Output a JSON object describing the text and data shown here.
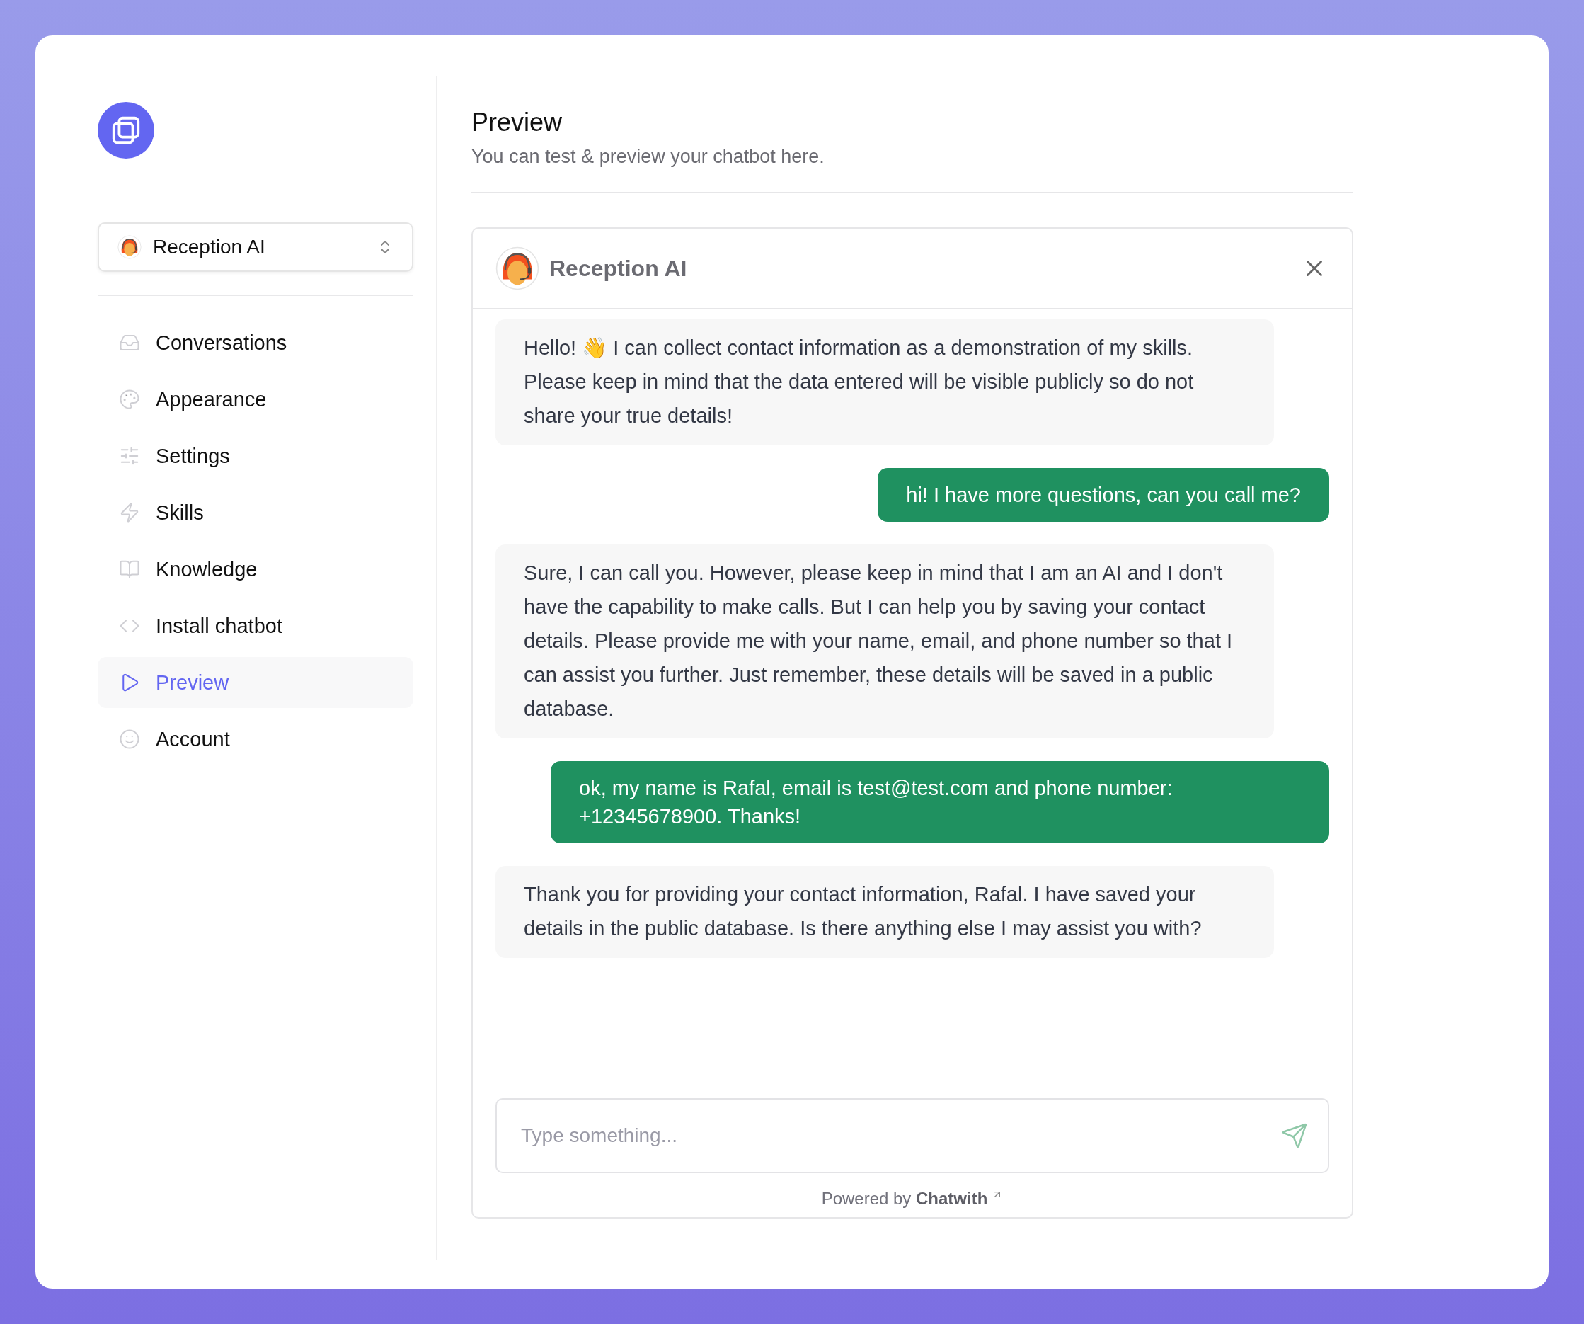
{
  "sidebar": {
    "bot_selector": {
      "label": "Reception AI"
    },
    "items": [
      {
        "label": "Conversations",
        "selected": false
      },
      {
        "label": "Appearance",
        "selected": false
      },
      {
        "label": "Settings",
        "selected": false
      },
      {
        "label": "Skills",
        "selected": false
      },
      {
        "label": "Knowledge",
        "selected": false
      },
      {
        "label": "Install chatbot",
        "selected": false
      },
      {
        "label": "Preview",
        "selected": true
      },
      {
        "label": "Account",
        "selected": false
      }
    ]
  },
  "header": {
    "title": "Preview",
    "subtitle": "You can test & preview your chatbot here."
  },
  "chat": {
    "title": "Reception AI",
    "messages": [
      {
        "kind": "bot",
        "text": "Hello! 👋 I can collect contact information as a demonstration of my skills. Please keep in mind that the data entered will be visible publicly so do not share your true details!"
      },
      {
        "kind": "user",
        "text": "hi! I have more questions, can you call me?"
      },
      {
        "kind": "bot",
        "text": "Sure, I can call you. However, please keep in mind that I am an AI and I don't have the capability to make calls. But I can help you by saving your contact details. Please provide me with your name, email, and phone number so that I can assist you further. Just remember, these details will be saved in a public database."
      },
      {
        "kind": "user",
        "text": "ok, my name is Rafal, email is test@test.com and phone number: +12345678900. Thanks!"
      },
      {
        "kind": "bot",
        "text": "Thank you for providing your contact information, Rafal. I have saved your details in the public database. Is there anything else I may assist you with?"
      }
    ],
    "input": {
      "placeholder": "Type something..."
    },
    "footer": "Powered by **Chatwith**"
  }
}
